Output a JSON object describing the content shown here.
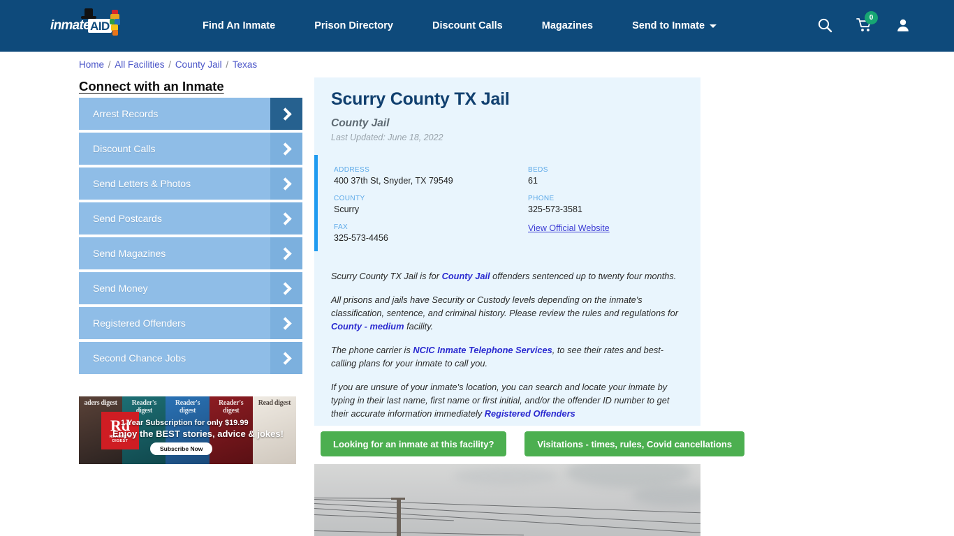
{
  "navbar": {
    "brand": {
      "word": "inmate",
      "badge": "AID",
      "icon": "inmateaid-logo"
    },
    "links": [
      {
        "label": "Find An Inmate",
        "has_caret": false
      },
      {
        "label": "Prison Directory",
        "has_caret": false
      },
      {
        "label": "Discount Calls",
        "has_caret": false
      },
      {
        "label": "Magazines",
        "has_caret": false
      },
      {
        "label": "Send to Inmate",
        "has_caret": true
      }
    ],
    "icons": {
      "search": "search-icon",
      "cart": "cart-icon",
      "cart_badge": "0",
      "account": "user-account-icon"
    },
    "colors": {
      "background": "#0e4a7b",
      "badge_green": "#17a673"
    }
  },
  "breadcrumb": {
    "items": [
      "Home",
      "All Facilities",
      "County Jail",
      "Texas"
    ],
    "separator": "/"
  },
  "sidebar": {
    "title": "Connect with an Inmate",
    "items": [
      {
        "label": "Arrest Records"
      },
      {
        "label": "Discount Calls"
      },
      {
        "label": "Send Letters & Photos"
      },
      {
        "label": "Send Postcards"
      },
      {
        "label": "Send Magazines"
      },
      {
        "label": "Send Money"
      },
      {
        "label": "Registered Offenders"
      },
      {
        "label": "Second Chance Jobs"
      }
    ],
    "colors": {
      "item_bg": "#8fbde7",
      "arrow_bg": "#7cb0de",
      "arrow_active_bg": "#26618f"
    }
  },
  "ad": {
    "magazine_headers": [
      "aders digest",
      "Reader's digest",
      "Reader's digest",
      "Reader's digest",
      "Read digest"
    ],
    "logo_main": "Rd",
    "logo_sub": "READER'S DIGEST",
    "line1": "1 Year Subscription for only $19.99",
    "line2": "Enjoy the BEST stories, advice & jokes!",
    "button": "Subscribe Now"
  },
  "facility": {
    "title": "Scurry County TX Jail",
    "subtitle": "County Jail",
    "last_updated": "Last Updated: June 18, 2022",
    "info_left": [
      {
        "label": "ADDRESS",
        "value": "400 37th St, Snyder, TX 79549"
      },
      {
        "label": "COUNTY",
        "value": "Scurry"
      },
      {
        "label": "FAX",
        "value": "325-573-4456"
      }
    ],
    "info_right": [
      {
        "label": "BEDS",
        "value": "61"
      },
      {
        "label": "PHONE",
        "value": "325-573-3581"
      }
    ],
    "official_website_link": "View Official Website",
    "accent_color": "#1f9bf0",
    "panel_bg": "#e9f5fd"
  },
  "description": {
    "p1_a": "Scurry County TX Jail is for ",
    "p1_link": "County Jail",
    "p1_b": " offenders sentenced up to twenty four months.",
    "p2_a": "All prisons and jails have Security or Custody levels depending on the inmate's classification, sentence, and criminal history. Please review the rules and regulations for ",
    "p2_link": "County - medium",
    "p2_b": " facility.",
    "p3_a": "The phone carrier is ",
    "p3_link": "NCIC Inmate Telephone Services",
    "p3_b": ", to see their rates and best-calling plans for your inmate to call you.",
    "p4_a": "If you are unsure of your inmate's location, you can search and locate your inmate by typing in their last name, first name or first initial, and/or the offender ID number to get their accurate information immediately ",
    "p4_link": "Registered Offenders"
  },
  "cta": {
    "buttons": [
      {
        "label": "Looking for an inmate at this facility?"
      },
      {
        "label": "Visitations - times, rules, Covid cancellations"
      }
    ],
    "color": "#4caf50"
  },
  "photo": {
    "alt": "facility-exterior-sky-photo"
  }
}
